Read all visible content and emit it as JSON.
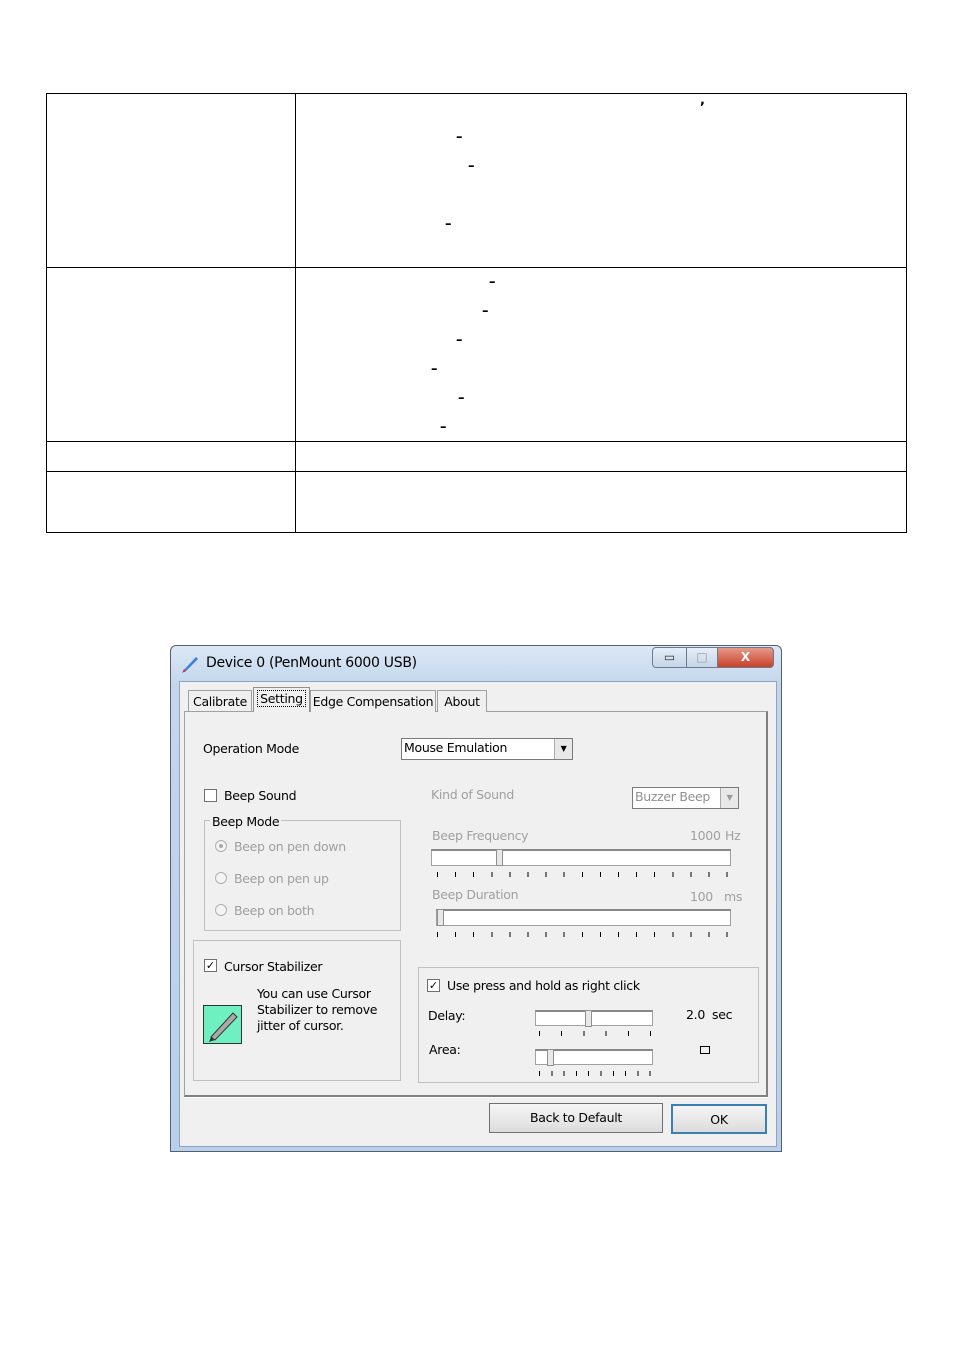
{
  "document_table": {
    "comma": ",",
    "dash": "–"
  },
  "dialog": {
    "title": "Device 0 (PenMount 6000 USB)",
    "window_buttons": {
      "minimize": "▭",
      "maximize": "□",
      "close": "X"
    },
    "tabs": [
      {
        "label": "Calibrate",
        "selected": false
      },
      {
        "label": "Setting",
        "selected": true
      },
      {
        "label": "Edge Compensation",
        "selected": false
      },
      {
        "label": "About",
        "selected": false
      }
    ],
    "operation_mode": {
      "label": "Operation Mode",
      "value": "Mouse Emulation"
    },
    "beep_sound": {
      "label": "Beep Sound",
      "checked": false
    },
    "beep_mode": {
      "label": "Beep Mode",
      "options": [
        {
          "label": "Beep on pen down",
          "selected": true
        },
        {
          "label": "Beep on pen up",
          "selected": false
        },
        {
          "label": "Beep on both",
          "selected": false
        }
      ]
    },
    "kind_of_sound": {
      "label": "Kind of Sound",
      "value": "Buzzer Beep"
    },
    "beep_frequency": {
      "label": "Beep Frequency",
      "value": "1000",
      "unit": "Hz",
      "level": 0.22
    },
    "beep_duration": {
      "label": "Beep Duration",
      "value": "100",
      "unit": "ms",
      "level": 0.0
    },
    "cursor_stabilizer": {
      "label": "Cursor Stabilizer",
      "checked": true,
      "description": [
        "You can use Cursor",
        "Stabilizer to remove",
        "jitter of cursor."
      ]
    },
    "right_click": {
      "label": "Use press and hold as right click",
      "checked": true,
      "delay": {
        "label": "Delay:",
        "value": "2.0",
        "unit": "sec",
        "level": 0.45
      },
      "area": {
        "label": "Area:",
        "level": 0.1
      }
    },
    "buttons": {
      "back_to_default": "Back to Default",
      "ok": "OK"
    }
  }
}
